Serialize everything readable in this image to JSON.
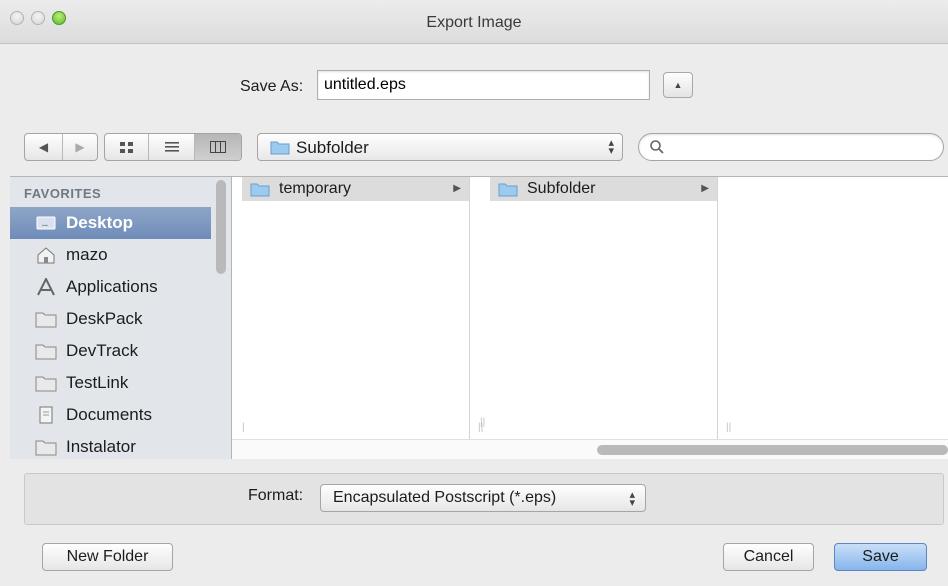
{
  "window": {
    "title": "Export Image"
  },
  "save_as": {
    "label": "Save As:",
    "value": "untitled.eps"
  },
  "toolbar": {
    "location": "Subfolder",
    "search_placeholder": ""
  },
  "sidebar": {
    "header": "FAVORITES",
    "items": [
      {
        "label": "Desktop",
        "icon": "desktop-icon",
        "selected": true
      },
      {
        "label": "mazo",
        "icon": "home-icon"
      },
      {
        "label": "Applications",
        "icon": "applications-icon"
      },
      {
        "label": "DeskPack",
        "icon": "folder-icon"
      },
      {
        "label": "DevTrack",
        "icon": "folder-icon"
      },
      {
        "label": "TestLink",
        "icon": "folder-icon"
      },
      {
        "label": "Documents",
        "icon": "documents-icon"
      },
      {
        "label": "Instalator",
        "icon": "folder-icon"
      }
    ]
  },
  "columns": [
    {
      "item": "temporary"
    },
    {
      "item": "Subfolder"
    },
    {
      "item": ""
    }
  ],
  "format": {
    "label": "Format:",
    "value": "Encapsulated Postscript (*.eps)"
  },
  "buttons": {
    "new_folder": "New Folder",
    "cancel": "Cancel",
    "save": "Save"
  },
  "colors": {
    "selection": "#7c96bf",
    "default_button": "#86b5ec",
    "folder": "#8fc0ea"
  }
}
